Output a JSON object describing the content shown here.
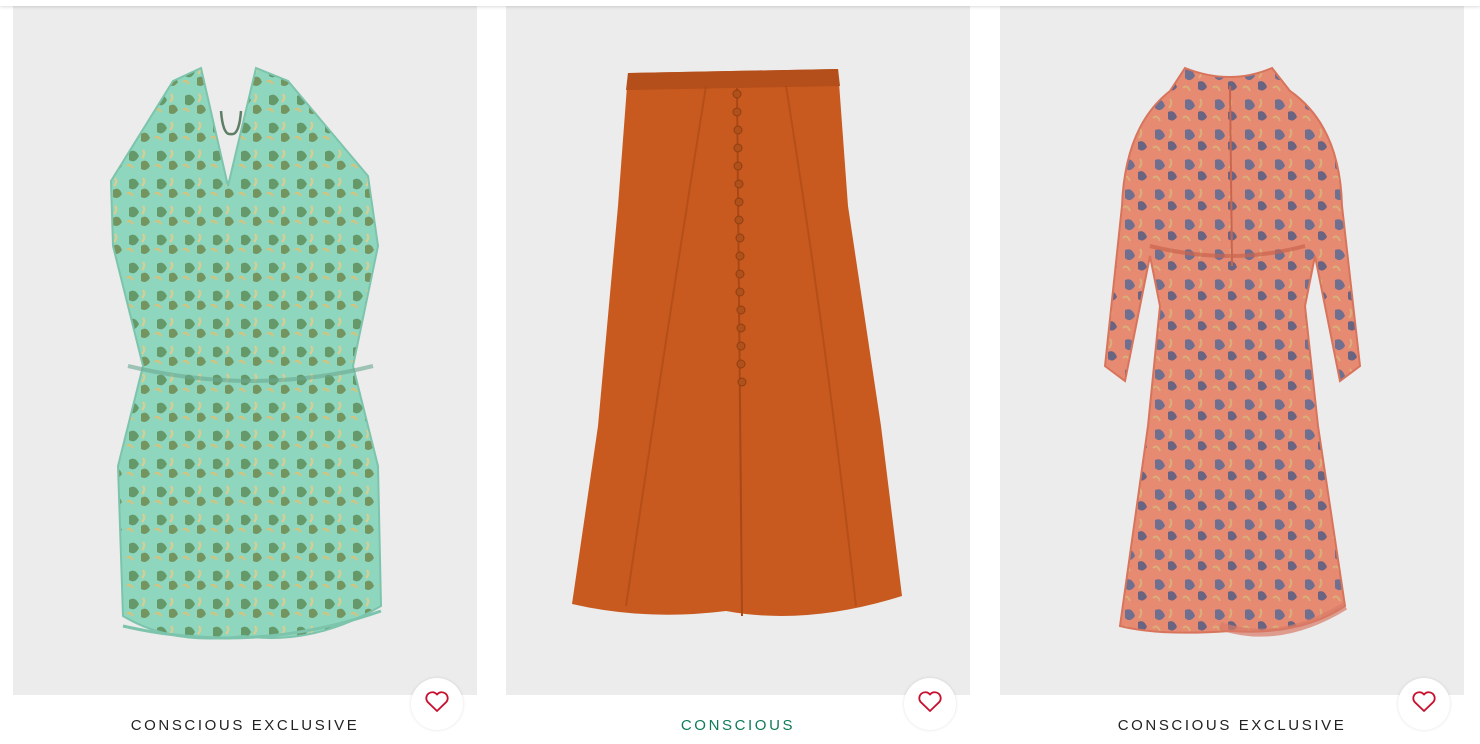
{
  "products": [
    {
      "label": "CONSCIOUS EXCLUSIVE",
      "label_color": "#222222",
      "image": "green-paisley-ruffle-dress",
      "favorite_icon": "heart-icon"
    },
    {
      "label": "CONSCIOUS",
      "label_color": "#0f7a5a",
      "image": "rust-orange-button-midi-skirt",
      "favorite_icon": "heart-icon"
    },
    {
      "label": "CONSCIOUS EXCLUSIVE",
      "label_color": "#222222",
      "image": "coral-printed-long-sleeve-dress",
      "favorite_icon": "heart-icon"
    }
  ],
  "colors": {
    "image_background": "#ececec",
    "heart": "#c8102e"
  }
}
